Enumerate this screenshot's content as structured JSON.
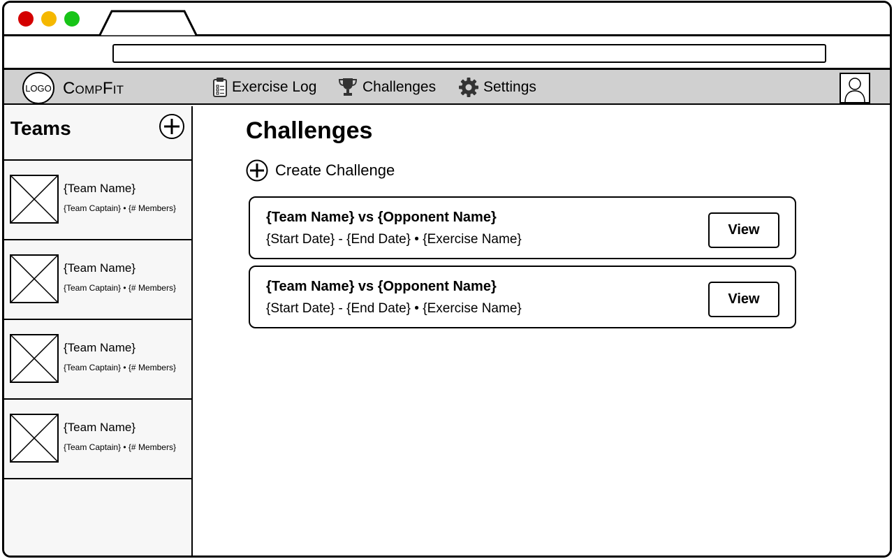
{
  "navbar": {
    "logo_text": "LOGO",
    "brand": "CompFit",
    "items": [
      {
        "label": "Exercise Log",
        "icon": "clipboard-icon"
      },
      {
        "label": "Challenges",
        "icon": "trophy-icon"
      },
      {
        "label": "Settings",
        "icon": "gear-icon"
      }
    ]
  },
  "sidebar": {
    "title": "Teams",
    "teams": [
      {
        "name": "{Team Name}",
        "meta": "{Team Captain} • {# Members}"
      },
      {
        "name": "{Team Name}",
        "meta": "{Team Captain} • {# Members}"
      },
      {
        "name": "{Team Name}",
        "meta": "{Team Captain} • {# Members}"
      },
      {
        "name": "{Team Name}",
        "meta": "{Team Captain} • {# Members}"
      }
    ]
  },
  "main": {
    "title": "Challenges",
    "create_label": "Create Challenge",
    "challenges": [
      {
        "title": "{Team Name} vs {Opponent Name}",
        "subtitle": "{Start Date} - {End Date} • {Exercise Name}",
        "button": "View"
      },
      {
        "title": "{Team Name} vs {Opponent Name}",
        "subtitle": "{Start Date} - {End Date} • {Exercise Name}",
        "button": "View"
      }
    ]
  }
}
